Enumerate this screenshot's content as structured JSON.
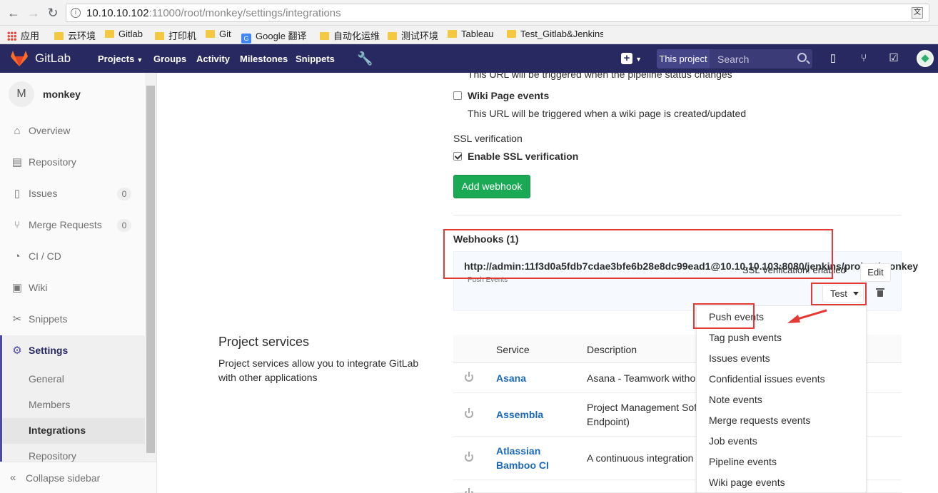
{
  "browser": {
    "url_host": "10.10.10.102",
    "url_rest": ":11000/root/monkey/settings/integrations",
    "bookmarks": [
      "应用",
      "云环境",
      "Gitlab",
      "打印机",
      "Git",
      "Google 翻译",
      "自动化运维",
      "测试环境",
      "Tableau",
      "Test_Gitlab&Jenkins"
    ]
  },
  "header": {
    "brand": "GitLab",
    "nav": [
      "Projects",
      "Groups",
      "Activity",
      "Milestones",
      "Snippets"
    ],
    "search_scope": "This project",
    "search_placeholder": "Search"
  },
  "sidebar": {
    "project_initial": "M",
    "project_name": "monkey",
    "items": [
      {
        "label": "Overview",
        "icon": "home-icon"
      },
      {
        "label": "Repository",
        "icon": "book-icon"
      },
      {
        "label": "Issues",
        "icon": "issues-icon",
        "count": "0"
      },
      {
        "label": "Merge Requests",
        "icon": "merge-request-icon",
        "count": "0"
      },
      {
        "label": "CI / CD",
        "icon": "rocket-icon"
      },
      {
        "label": "Wiki",
        "icon": "book-icon"
      },
      {
        "label": "Snippets",
        "icon": "scissors-icon"
      },
      {
        "label": "Settings",
        "icon": "gear-icon"
      }
    ],
    "sub_items": [
      "General",
      "Members",
      "Integrations",
      "Repository"
    ],
    "collapse_label": "Collapse sidebar"
  },
  "webhook_form": {
    "pipeline_help": "This URL will be triggered when the pipeline status changes",
    "wiki_label": "Wiki Page events",
    "wiki_help": "This URL will be triggered when a wiki page is created/updated",
    "ssl_heading": "SSL verification",
    "ssl_label": "Enable SSL verification",
    "add_button": "Add webhook"
  },
  "webhooks": {
    "heading": "Webhooks (1)",
    "url": "http://admin:11f3d0a5fdb7cdae3bfe6b28e8dc99ead1@10.10.10.103:8080/jenkins/project/monkey",
    "events": "Push Events",
    "ssl_status": "SSL Verification: enabled",
    "edit_label": "Edit",
    "test_label": "Test"
  },
  "test_menu": [
    "Push events",
    "Tag push events",
    "Issues events",
    "Confidential issues events",
    "Note events",
    "Merge requests events",
    "Job events",
    "Pipeline events",
    "Wiki page events"
  ],
  "services": {
    "title": "Project services",
    "description": "Project services allow you to integrate GitLab with other applications",
    "col_service": "Service",
    "col_description": "Description",
    "rows": [
      {
        "name": "Asana",
        "desc": "Asana - Teamwork without"
      },
      {
        "name": "Assembla",
        "desc_1": "Project Management Sof",
        "desc_2": "Endpoint)"
      },
      {
        "name_1": "Atlassian",
        "name_2": "Bamboo CI",
        "desc": "A continuous integration"
      }
    ]
  },
  "colors": {
    "header_bg": "#292961",
    "accent_green": "#1aaa55",
    "link_blue": "#1b69b6",
    "annotation_red": "#e53935"
  }
}
